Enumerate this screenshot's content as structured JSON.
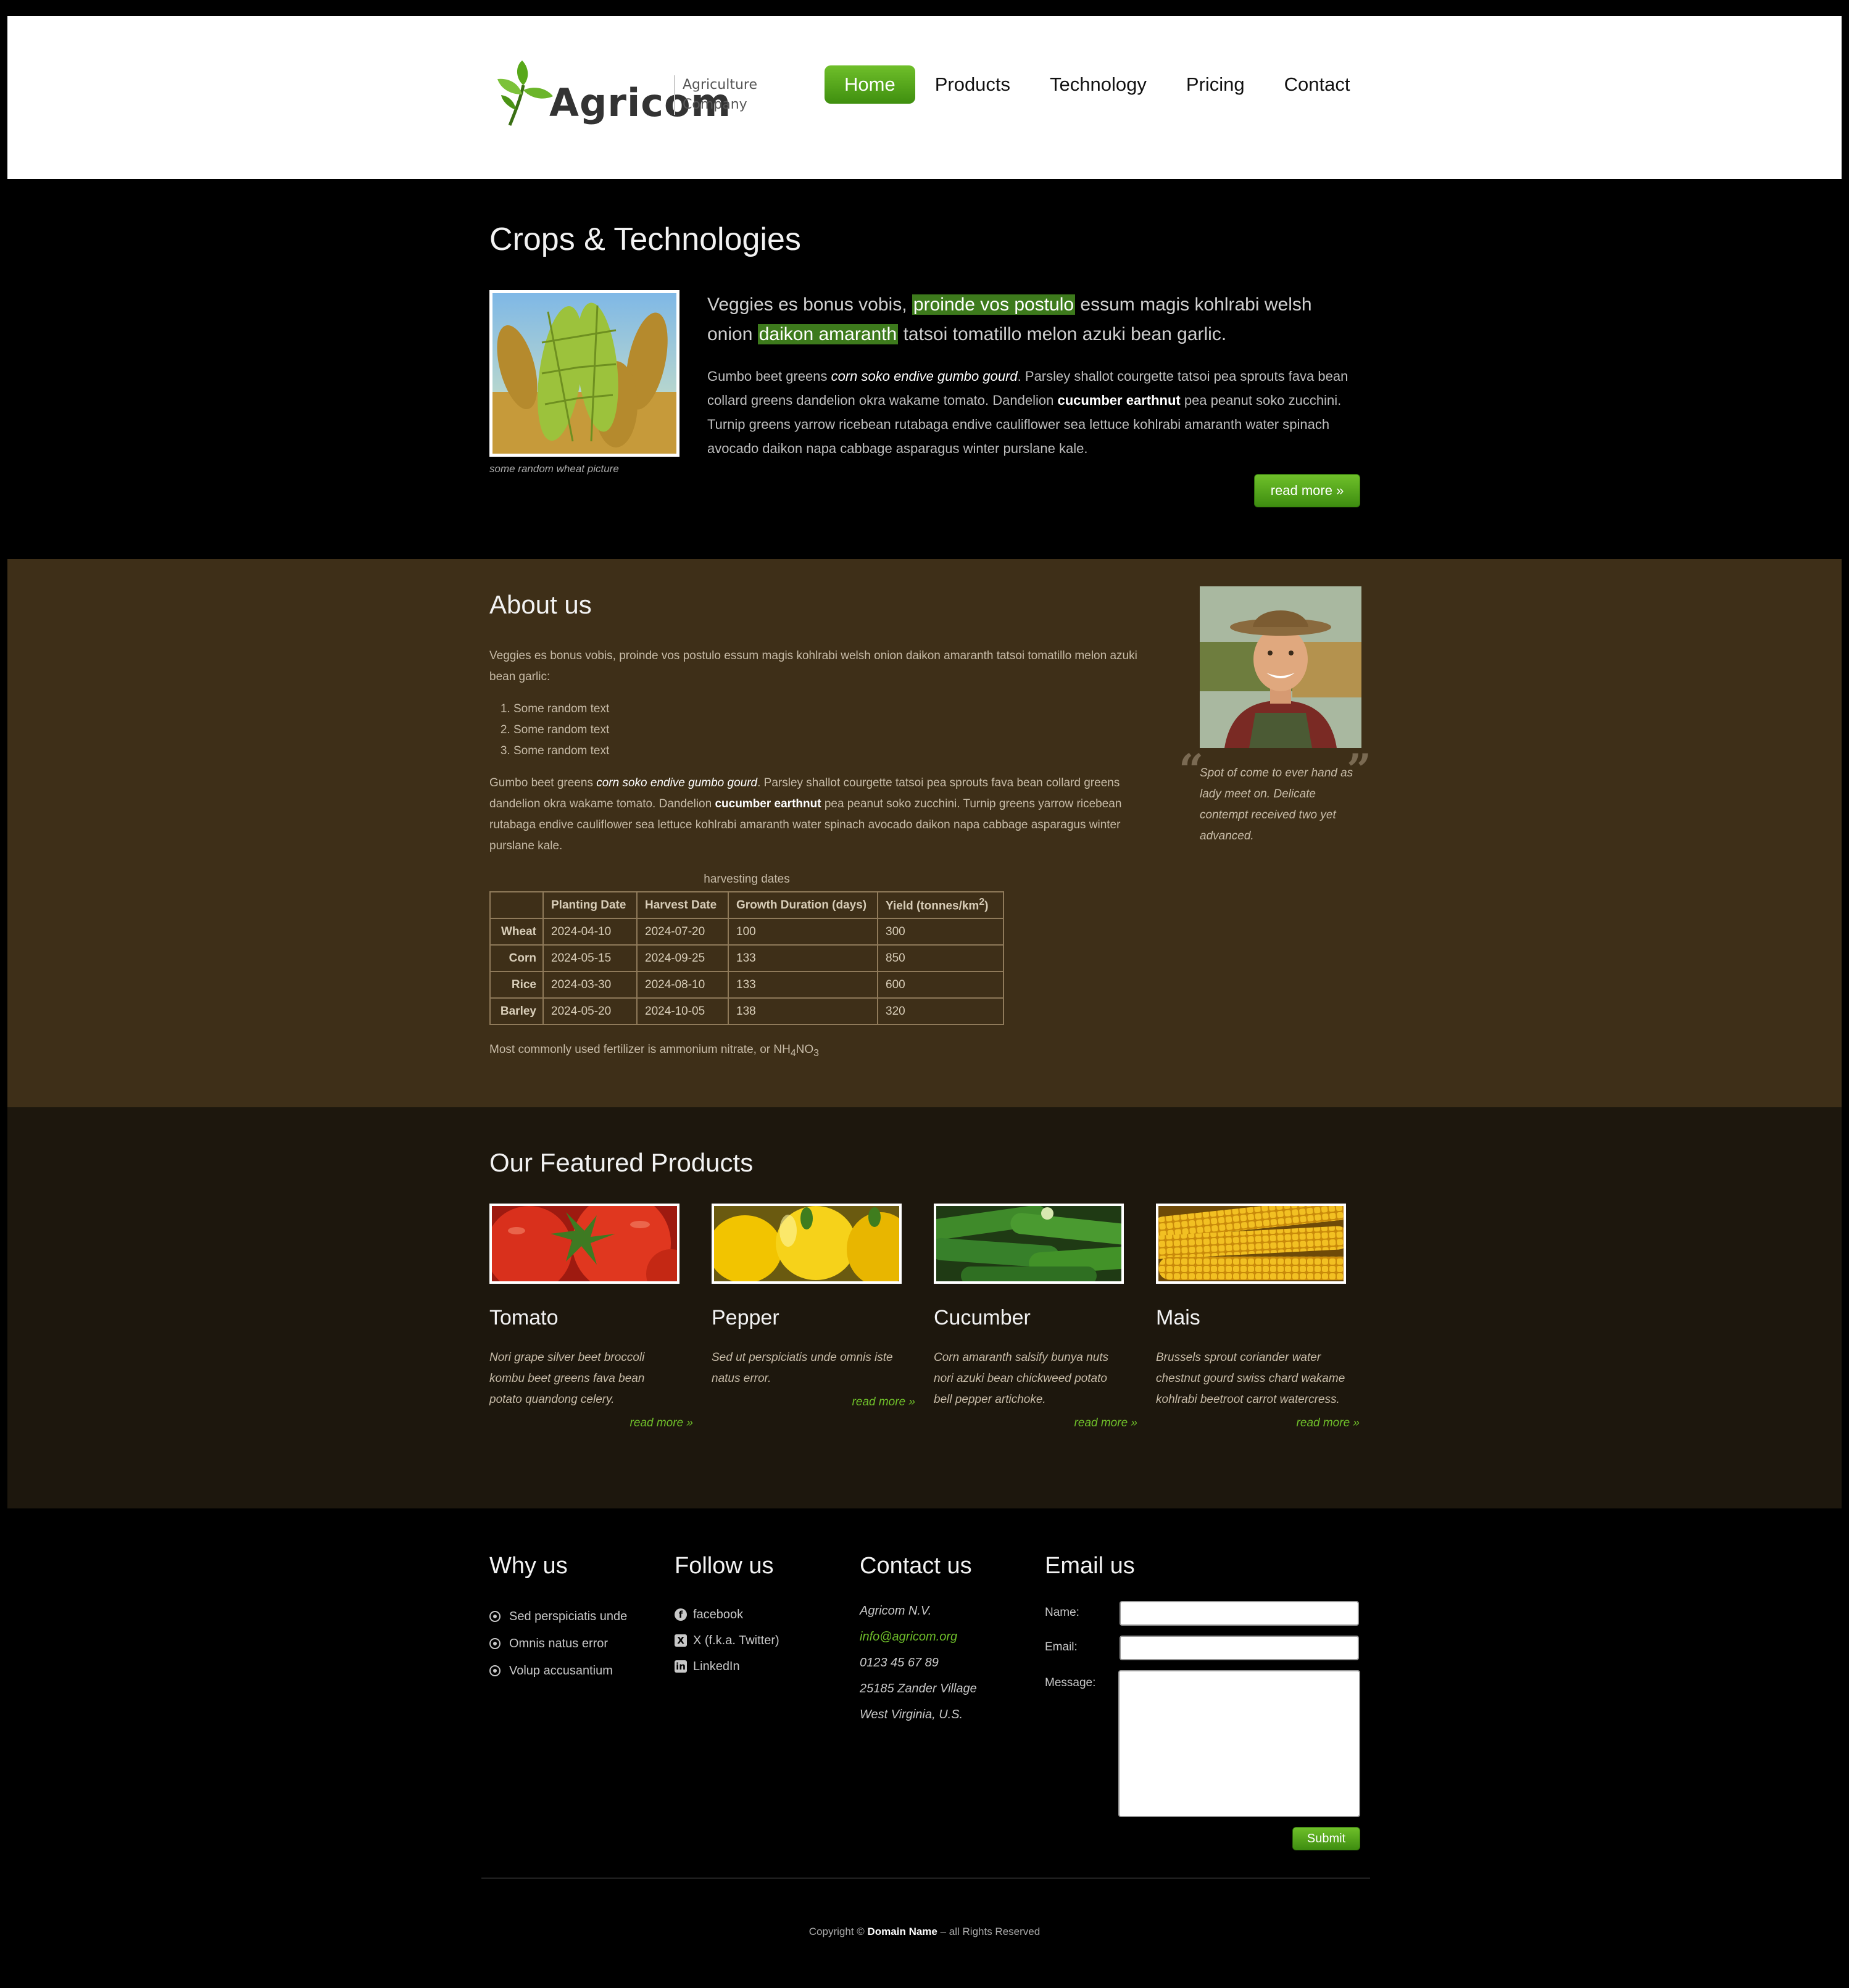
{
  "header": {
    "logo_name": "Agricom",
    "logo_sub_1": "Agriculture",
    "logo_sub_2": "Company",
    "nav": [
      "Home",
      "Products",
      "Technology",
      "Pricing",
      "Contact"
    ],
    "nav_active": "Home",
    "accent": "#5aa91e"
  },
  "crops": {
    "title": "Crops & Technologies",
    "image_caption": "some random wheat picture",
    "lead_1": "Veggies es bonus vobis, ",
    "lead_hl_1": "proinde vos postulo",
    "lead_2": " essum magis kohlrabi welsh onion ",
    "lead_hl_2": "daikon amaranth",
    "lead_3": " tatsoi tomatillo melon azuki bean garlic.",
    "body_1": "Gumbo beet greens ",
    "body_em": "corn soko endive gumbo gourd",
    "body_2": ". Parsley shallot courgette tatsoi pea sprouts fava bean collard greens dandelion okra wakame tomato. Dandelion ",
    "body_b": "cucumber earthnut",
    "body_3": " pea peanut soko zucchini. Turnip greens yarrow ricebean rutabaga endive cauliflower sea lettuce kohlrabi amaranth water spinach avocado daikon napa cabbage asparagus winter purslane kale.",
    "read_more": "read more »"
  },
  "about": {
    "title": "About us",
    "p1": "Veggies es bonus vobis, proinde vos postulo essum magis kohlrabi welsh onion daikon amaranth tatsoi tomatillo melon azuki bean garlic:",
    "list": [
      "Some random text",
      "Some random text",
      "Some random text"
    ],
    "p2_1": "Gumbo beet greens ",
    "p2_em": "corn soko endive gumbo gourd",
    "p2_2": ". Parsley shallot courgette tatsoi pea sprouts fava bean collard greens dandelion okra wakame tomato. Dandelion ",
    "p2_b": "cucumber earthnut",
    "p2_3": " pea peanut soko zucchini. Turnip greens yarrow ricebean rutabaga endive cauliflower sea lettuce kohlrabi amaranth water spinach avocado daikon napa cabbage asparagus winter purslane kale.",
    "table_caption": "harvesting dates",
    "table_headers": [
      "",
      "Planting Date",
      "Harvest Date",
      "Growth Duration (days)",
      "Yield (tonnes/km"
    ],
    "table_headers_sup": "2",
    "table_headers_close": ")",
    "table_rows": [
      [
        "Wheat",
        "2024-04-10",
        "2024-07-20",
        "100",
        "300"
      ],
      [
        "Corn",
        "2024-05-15",
        "2024-09-25",
        "133",
        "850"
      ],
      [
        "Rice",
        "2024-03-30",
        "2024-08-10",
        "133",
        "600"
      ],
      [
        "Barley",
        "2024-05-20",
        "2024-10-05",
        "138",
        "320"
      ]
    ],
    "fert_text": "Most commonly used fertilizer is ammonium nitrate, or NH",
    "fert_sub1": "4",
    "fert_mid": "NO",
    "fert_sub2": "3",
    "quote": "Spot of come to ever hand as lady meet on. Delicate contempt received two yet advanced."
  },
  "featured": {
    "title": "Our Featured Products",
    "products": [
      {
        "name": "Tomato",
        "desc": "Nori grape silver beet broccoli kombu beet greens fava bean potato quandong celery.",
        "more": "read more »"
      },
      {
        "name": "Pepper",
        "desc": "Sed ut perspiciatis unde omnis iste natus error.",
        "more": "read more »"
      },
      {
        "name": "Cucumber",
        "desc": "Corn amaranth salsify bunya nuts nori azuki bean chickweed potato bell pepper artichoke.",
        "more": "read more »"
      },
      {
        "name": "Mais",
        "desc": "Brussels sprout coriander water chestnut gourd swiss chard wakame kohlrabi beetroot carrot watercress.",
        "more": "read more »"
      }
    ]
  },
  "footer": {
    "why_title": "Why us",
    "why_items": [
      "Sed perspiciatis unde",
      "Omnis natus error",
      "Volup accusantium"
    ],
    "follow_title": "Follow us",
    "follow_items": [
      "facebook",
      "X (f.k.a. Twitter)",
      "LinkedIn"
    ],
    "contact_title": "Contact us",
    "contact_lines": [
      "Agricom N.V.",
      "info@agricom.org",
      "0123 45 67 89",
      "25185 Zander Village",
      "West Virginia, U.S."
    ],
    "email_title": "Email us",
    "label_name": "Name:",
    "label_email": "Email:",
    "label_message": "Message:",
    "submit": "Submit",
    "copy_1": "Copyright © ",
    "copy_b": "Domain Name",
    "copy_2": " – all Rights Reserved"
  }
}
